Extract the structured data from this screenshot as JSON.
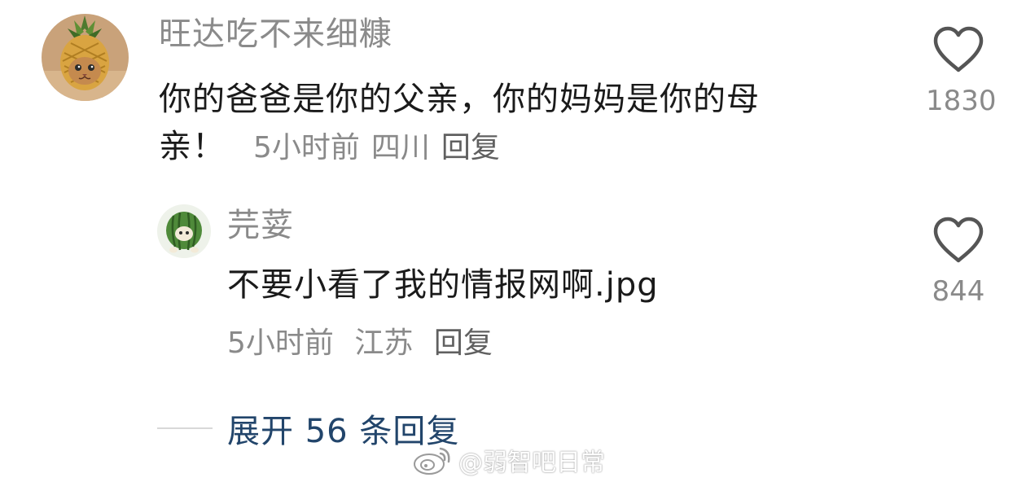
{
  "comment": {
    "username": "旺达吃不来细糠",
    "text_line1": "你的爸爸是你的父亲，你的妈妈是你的母",
    "text_line2": "亲！",
    "time": "5小时前",
    "location": "四川",
    "reply_label": "回复",
    "like_count": "1830",
    "avatar_icon": "pineapple-cat-avatar"
  },
  "reply": {
    "username": "芫荽",
    "text": "不要小看了我的情报网啊.jpg",
    "time": "5小时前",
    "location": "江苏",
    "reply_label": "回复",
    "like_count": "844",
    "avatar_icon": "watermelon-creature-avatar"
  },
  "expand": {
    "label": "展开 56 条回复"
  },
  "watermark": {
    "text": "@弱智吧日常",
    "icon": "weibo-logo-icon"
  },
  "colors": {
    "text_primary": "#1a1a1a",
    "text_secondary": "#8a8a8a",
    "expand_link": "#22456b",
    "background": "#ffffff"
  }
}
